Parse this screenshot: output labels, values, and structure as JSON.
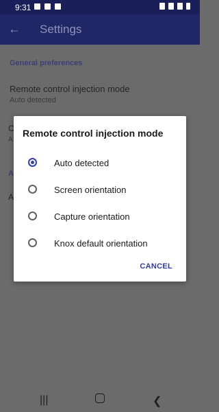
{
  "status_bar": {
    "time": "9:31",
    "icons_left": [
      "image-icon",
      "cast-icon",
      "x-box-icon"
    ],
    "icons_right": [
      "mute-icon",
      "wifi-icon",
      "signal-icon",
      "battery-icon"
    ]
  },
  "app_bar": {
    "title": "Settings",
    "back_icon": "arrow-left-icon"
  },
  "settings": {
    "section1": "General preferences",
    "pref1_label": "Remote control injection mode",
    "pref1_summary": "Auto detected",
    "pref2_label_peek": "C",
    "pref2_summary_peek": "A",
    "section2_peek": "A",
    "pref3_label_peek": "A"
  },
  "dialog": {
    "title": "Remote control injection mode",
    "options": [
      {
        "label": "Auto detected",
        "selected": true
      },
      {
        "label": "Screen orientation",
        "selected": false
      },
      {
        "label": "Capture orientation",
        "selected": false
      },
      {
        "label": "Knox default orientation",
        "selected": false
      }
    ],
    "cancel": "CANCEL"
  },
  "colors": {
    "status_bar_bg": "#1a1f5a",
    "app_bar_bg": "#1f2766",
    "accent": "#3040a8",
    "dim_overlay_bg": "#6b6b6b"
  }
}
